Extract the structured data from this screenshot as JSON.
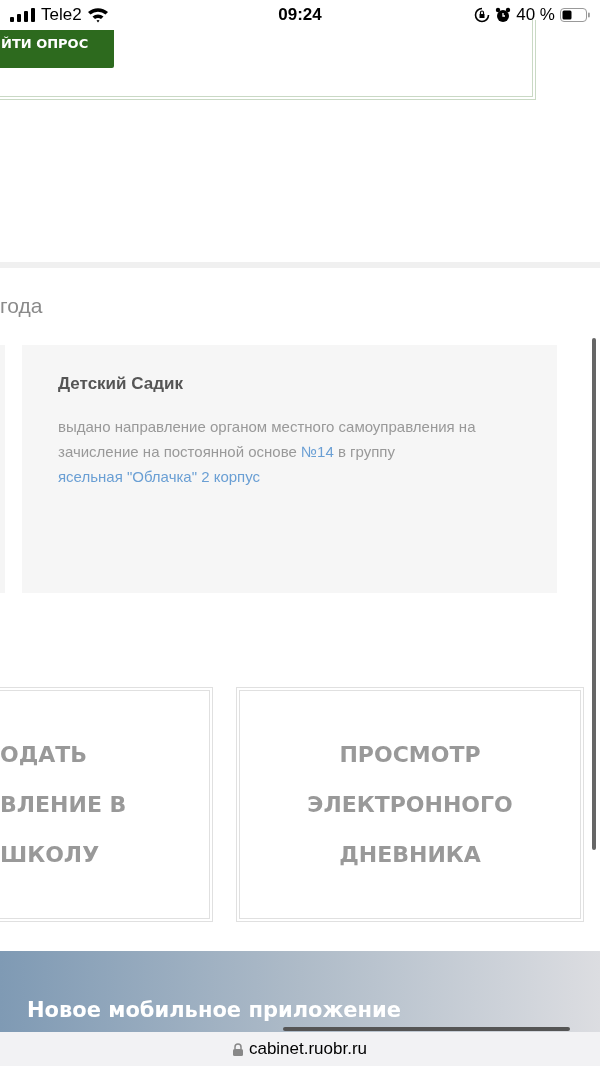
{
  "status_bar": {
    "carrier": "Tele2",
    "time": "09:24",
    "battery": "40 %"
  },
  "survey": {
    "button": "ЙТИ ОПРОС"
  },
  "section": {
    "heading": "года"
  },
  "card": {
    "title": "Детский Садик",
    "description": [
      {
        "kind": "plain",
        "text": "выдано направление органом местного самоуправления на зачисление на постоянной основе "
      },
      {
        "kind": "link",
        "text": "№14"
      },
      {
        "kind": "plain",
        "text": " в группу "
      },
      {
        "kind": "link",
        "text": "ясельная \"Облачка\" 2 корпус"
      }
    ]
  },
  "tiles": [
    {
      "lines": [
        "ОДАТЬ",
        "ВЛЕНИЕ В",
        "ШКОЛУ"
      ],
      "cut": true
    },
    {
      "lines": [
        "ПРОСМОТР",
        "ЭЛЕКТРОННОГО",
        "ДНЕВНИКА"
      ],
      "cut": false
    }
  ],
  "banner": {
    "title": "Новое мобильное приложение"
  },
  "url_bar": {
    "url": "cabinet.ruobr.ru"
  }
}
